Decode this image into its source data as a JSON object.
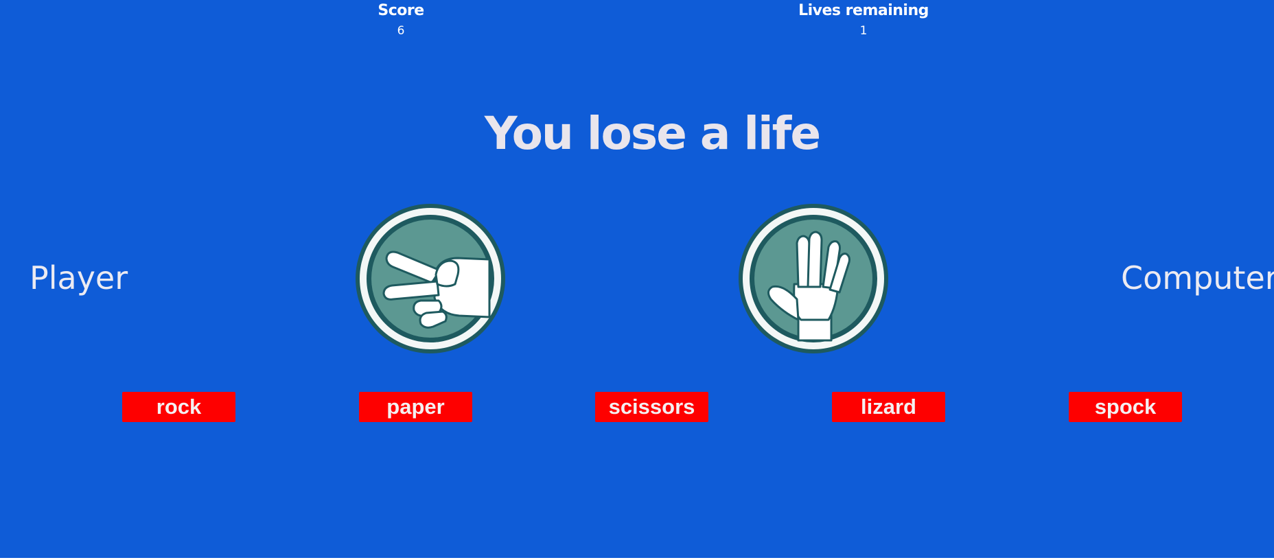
{
  "hud": {
    "score_label": "Score",
    "score_value": "6",
    "lives_label": "Lives remaining",
    "lives_value": "1"
  },
  "result_message": "You lose a life",
  "player_label": "Player",
  "computer_label": "Computer",
  "player_choice_icon": "scissors-hand-icon",
  "computer_choice_icon": "spock-hand-icon",
  "choices": [
    "rock",
    "paper",
    "scissors",
    "lizard",
    "spock"
  ],
  "colors": {
    "background": "#0f5cd7",
    "button": "#fe0000",
    "button_text": "#f4f0f2",
    "badge_fill": "#5c9892",
    "badge_ring": "#1e5a5f"
  }
}
